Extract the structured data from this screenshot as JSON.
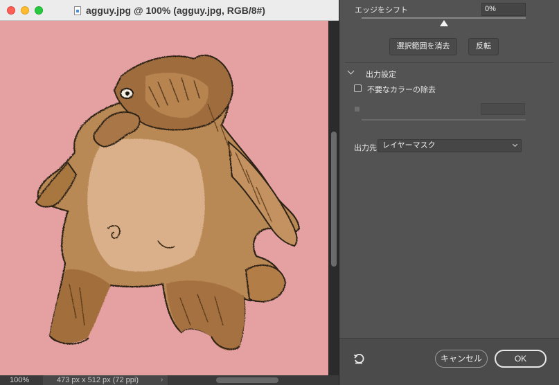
{
  "window": {
    "title": "agguy.jpg @ 100% (agguy.jpg, RGB/8#)"
  },
  "status": {
    "zoom": "100%",
    "doc_info": "473 px x 512 px (72 ppi)",
    "info_arrow": "›"
  },
  "panel": {
    "shift_edge_label": "エッジをシフト",
    "shift_edge_value": "0%",
    "shift_edge_level_percent": 0,
    "clear_selection_button": "選択範囲を消去",
    "invert_button": "反転",
    "output_section_title": "出力設定",
    "decontaminate_label": "不要なカラーの除去",
    "decontaminate_checked": false,
    "amount_value": "",
    "output_to_label": "出力先",
    "output_to_value": "レイヤーマスク"
  },
  "footer": {
    "cancel_button": "キャンセル",
    "ok_button": "OK"
  },
  "icons": {
    "document": "document-icon",
    "reset": "reset-icon",
    "section_toggle": "chevron-down-icon",
    "select_dropdown": "chevron-down-icon"
  },
  "colors": {
    "canvas_background": "#e6a3a4",
    "panel_background": "#535353",
    "close": "#ff5f57",
    "minimize": "#febc2e",
    "maximize": "#28c840"
  },
  "image": {
    "subject": "hand-drawn brown bear-like creature on pink paper"
  }
}
